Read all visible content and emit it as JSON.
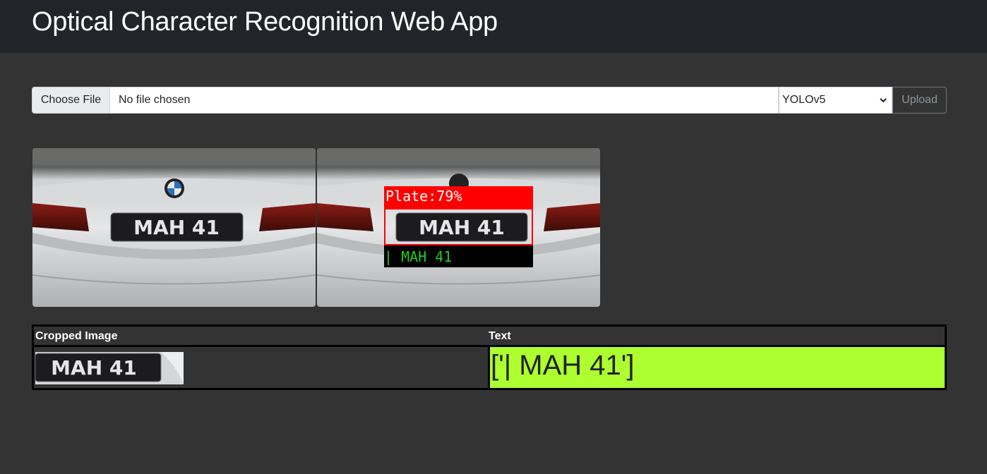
{
  "header": {
    "title": "Optical Character Recognition Web App"
  },
  "form": {
    "choose_file_label": "Choose File",
    "file_status": "No file chosen",
    "model_selected": "YOLOv5",
    "upload_label": "Upload"
  },
  "images": {
    "original": {
      "plate_text": "MAH 41"
    },
    "detected": {
      "plate_text": "MAH 41",
      "detection_label": "Plate:79%",
      "ocr_overlay": "| MAH 41"
    }
  },
  "results_table": {
    "headers": [
      "Cropped Image",
      "Text"
    ],
    "rows": [
      {
        "cropped_plate_text": "MAH 41",
        "text": "['| MAH 41']"
      }
    ]
  },
  "colors": {
    "background": "#333333",
    "navbar": "#212529",
    "detection_box": "#ff0000",
    "ocr_text": "#22cc22",
    "result_highlight": "#adff2f"
  }
}
